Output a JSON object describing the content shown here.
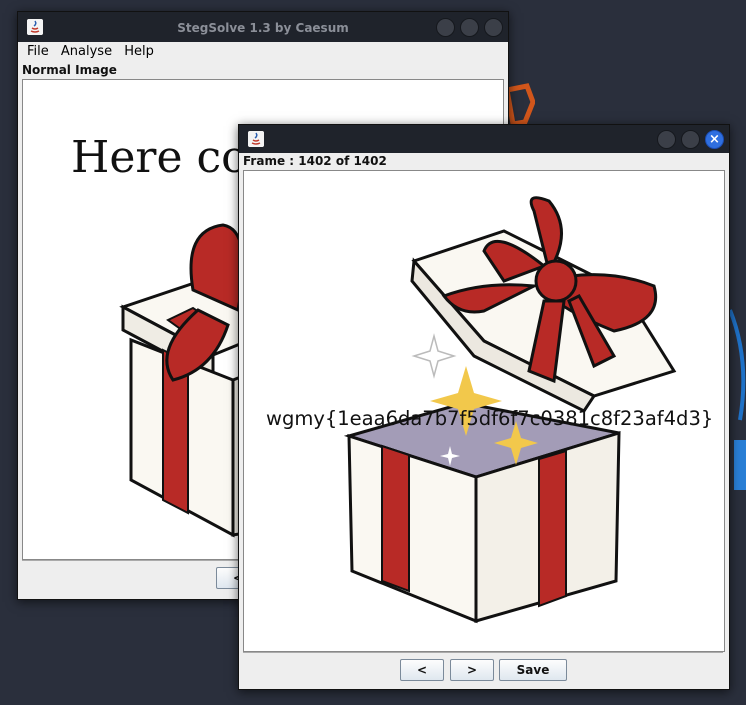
{
  "main_window": {
    "title": "StegSolve 1.3 by Caesum",
    "menu": [
      "File",
      "Analyse",
      "Help"
    ],
    "caption": "Normal Image",
    "image_text": "Here come",
    "button_prev": "<"
  },
  "frame_window": {
    "caption": "Frame : 1402 of 1402",
    "flag_text": "wgmy{1eaa6da7b7f5df6f7c0381c8f23af4d3}",
    "buttons": {
      "prev": "<",
      "next": ">",
      "save": "Save"
    }
  },
  "colors": {
    "accent_close": "#2f6fe0",
    "desktop": "#2a2f3c",
    "ribbon": "#b82a26"
  }
}
